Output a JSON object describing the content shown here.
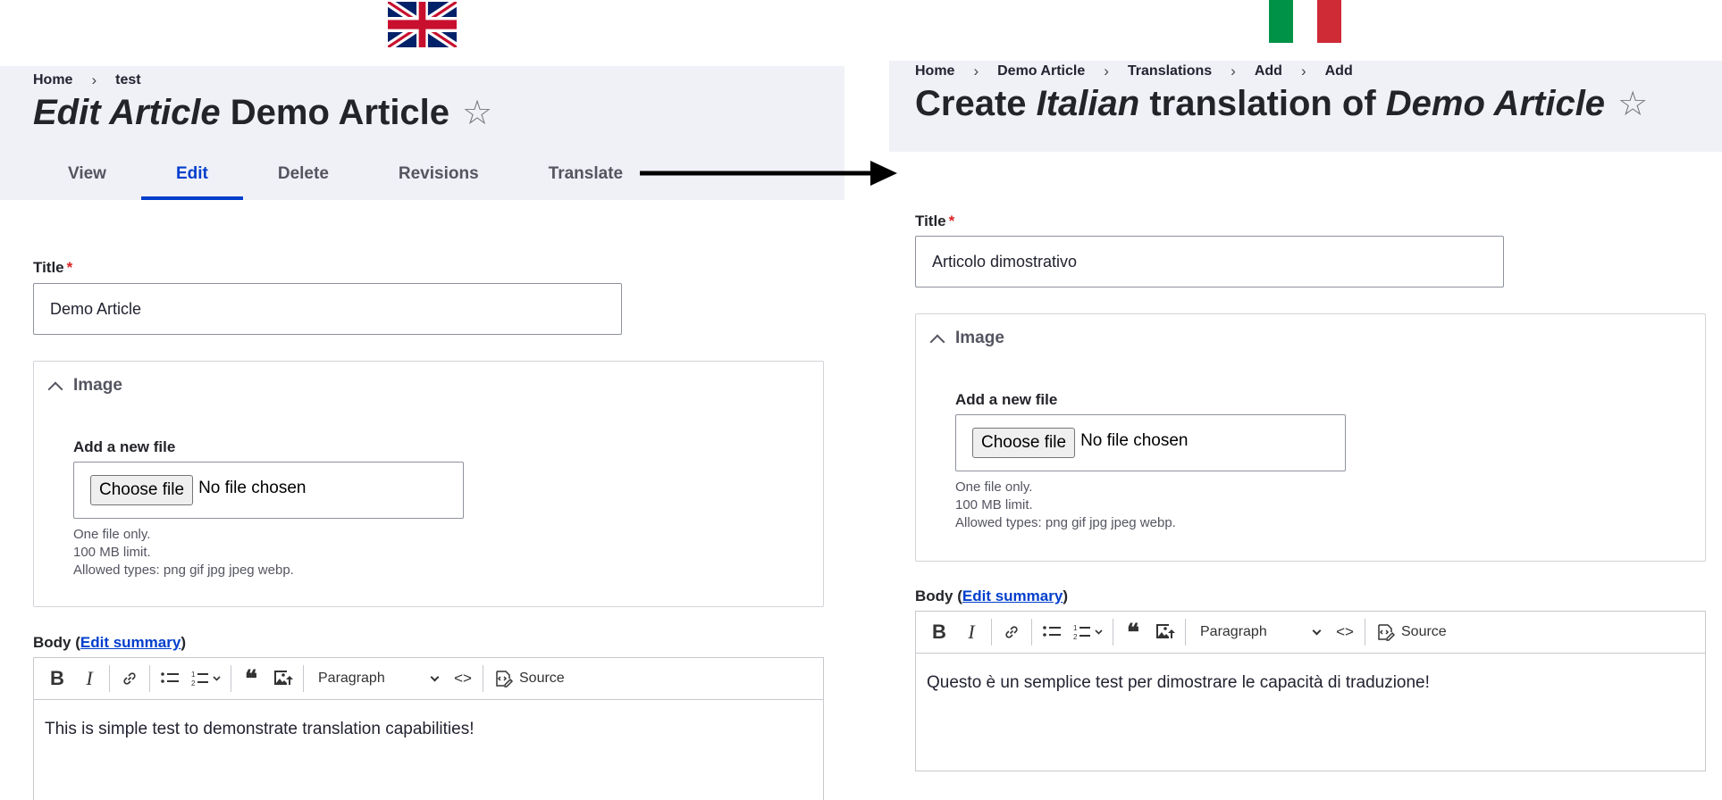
{
  "flags": {
    "left": {
      "name": "uk-flag",
      "colors": {
        "blue": "#012169",
        "red": "#C8102E",
        "white": "#FFFFFF"
      }
    },
    "right": {
      "name": "italy-flag",
      "colors": [
        "#009246",
        "#FFFFFF",
        "#CE2B37"
      ]
    }
  },
  "left": {
    "breadcrumb": [
      "Home",
      "test"
    ],
    "title": {
      "prefix": "Edit Article",
      "rest": " Demo Article"
    },
    "star": "☆",
    "tabs": [
      {
        "label": "View",
        "active": false
      },
      {
        "label": "Edit",
        "active": true
      },
      {
        "label": "Delete",
        "active": false
      },
      {
        "label": "Revisions",
        "active": false
      },
      {
        "label": "Translate",
        "active": false
      }
    ],
    "title_field": {
      "label": "Title",
      "required_mark": "*",
      "value": "Demo Article"
    },
    "image": {
      "summary": "Image",
      "add_label": "Add a new file",
      "choose_button": "Choose file",
      "no_file": "No file chosen",
      "help": [
        "One file only.",
        "100 MB limit.",
        "Allowed types: png gif jpg jpeg webp."
      ]
    },
    "body": {
      "label_prefix": "Body (",
      "edit_summary": "Edit summary",
      "label_suffix": ")",
      "format": "Paragraph",
      "source": "Source",
      "content": "This is simple test to demonstrate translation capabilities!"
    }
  },
  "right": {
    "breadcrumb": [
      "Home",
      "Demo Article",
      "Translations",
      "Add",
      "Add"
    ],
    "title": {
      "part1": "Create ",
      "lang": "Italian",
      "part2": " translation of ",
      "article": "Demo Article"
    },
    "star": "☆",
    "title_field": {
      "label": "Title",
      "required_mark": "*",
      "value": "Articolo dimostrativo"
    },
    "image": {
      "summary": "Image",
      "add_label": "Add a new file",
      "choose_button": "Choose file",
      "no_file": "No file chosen",
      "help": [
        "One file only.",
        "100 MB limit.",
        "Allowed types: png gif jpg jpeg webp."
      ]
    },
    "body": {
      "label_prefix": "Body (",
      "edit_summary": "Edit summary",
      "label_suffix": ")",
      "format": "Paragraph",
      "source": "Source",
      "content": "Questo è un semplice test per dimostrare le capacità di traduzione!"
    }
  },
  "colors": {
    "accent": "#003ecc",
    "header_bg": "#f0f1f7",
    "required": "#dc2323"
  }
}
